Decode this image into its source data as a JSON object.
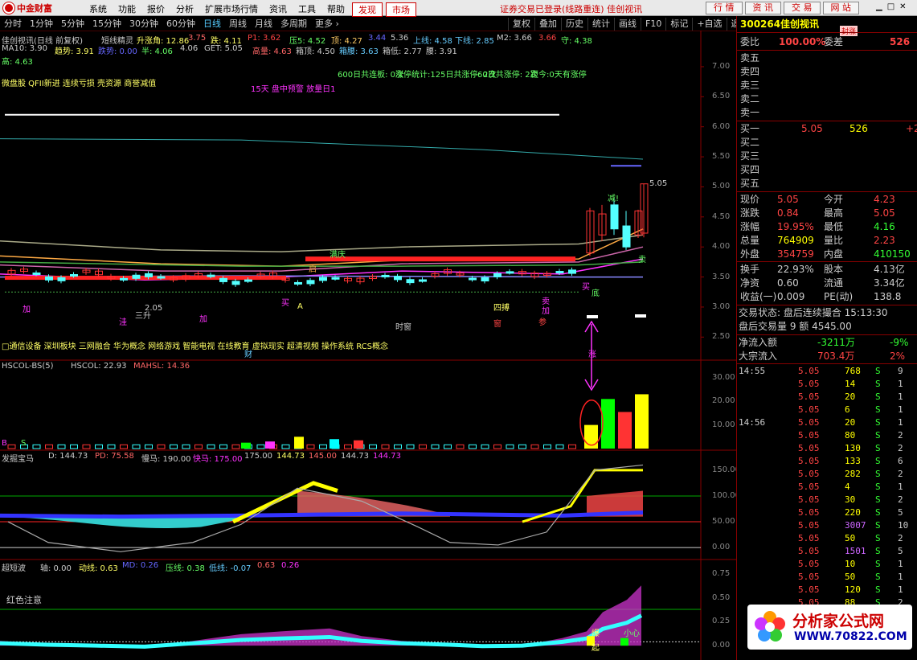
{
  "app": {
    "brand": "中金财富",
    "menu": [
      "系统",
      "功能",
      "报价",
      "分析",
      "扩展市场行情",
      "资讯",
      "工具",
      "帮助"
    ],
    "menu_red": [
      "发现",
      "市场"
    ],
    "notice": "证券交易已登录(线路重连) 佳创视讯",
    "top_buttons": [
      "行 情",
      "资 讯",
      "交 易",
      "网 站"
    ]
  },
  "periods": [
    "分时",
    "1分钟",
    "5分钟",
    "15分钟",
    "30分钟",
    "60分钟",
    "日线",
    "周线",
    "月线",
    "多周期",
    "更多 ›"
  ],
  "active_period": "日线",
  "tools": [
    "复权",
    "叠加",
    "历史",
    "统计",
    "画线",
    "F10",
    "标记",
    "+自选",
    "返回"
  ],
  "main": {
    "title": "佳创视讯(日线 前复权)",
    "indicator": "短线精灵",
    "l1": [
      [
        "升涨角: 12.86",
        "#ff6"
      ],
      [
        "3.75",
        "#f66"
      ],
      [
        "跌: 4.11",
        "#ff6"
      ],
      [
        "P1: 3.62",
        "#f44"
      ],
      [
        "压5: 4.52",
        "#6f6"
      ],
      [
        "顶: 4.27",
        "#fc6"
      ],
      [
        "3.44",
        "#66f"
      ],
      [
        "5.36",
        "#ccc"
      ],
      [
        "上线: 4.58",
        "#6cf"
      ],
      [
        "下线: 2.85",
        "#6cf"
      ],
      [
        "M2: 3.66",
        "#ccc"
      ],
      [
        "3.66",
        "#f44"
      ],
      [
        "守: 4.38",
        "#6f6"
      ]
    ],
    "l2": [
      [
        "MA10: 3.90",
        "#ccc"
      ],
      [
        "趋势: 3.91",
        "#ff6"
      ],
      [
        "跌势: 0.00",
        "#66f"
      ],
      [
        "半: 4.06",
        "#6f6"
      ],
      [
        "4.06",
        "#ccc"
      ],
      [
        "GET: 5.05",
        "#ccc"
      ],
      [
        "高量: 4.63",
        "#f66"
      ],
      [
        "箱顶: 4.50",
        "#ccc"
      ],
      [
        "箱腰: 3.63",
        "#6cf"
      ],
      [
        "箱低: 2.77",
        "#ccc"
      ],
      [
        "腰: 3.91",
        "#ccc"
      ]
    ],
    "l3": "高: 4.63",
    "stats": [
      "600日共连板: 0次",
      "涨停统计:125日共涨停: 2次",
      "60日共涨停: 2次",
      "距今:0天有涨停"
    ],
    "concept1": "微盘股 QFII新进 连续亏损 壳资源 商誉减值",
    "warn": "15天 盘中预警 放量日1",
    "concept2": "□通信设备 深圳板块 三网融合 华为概念 网络游戏 智能电视 在线教育 虚拟现实 超清视频 操作系统 RCS概念",
    "yticks": [
      "7.00",
      "6.50",
      "6.00",
      "5.50",
      "5.00",
      "4.50",
      "4.00",
      "3.50",
      "3.00",
      "2.50"
    ],
    "price_tag": "5.05",
    "marks": [
      "加",
      "洼",
      "三升",
      "加",
      "A",
      "买",
      "时窗",
      "四搏",
      "窗",
      "加",
      "卖",
      "参",
      "减!",
      "满庆",
      "启",
      "底",
      "卖",
      "涨",
      "买",
      "财",
      "2.05"
    ]
  },
  "sub1": {
    "title": "HSCOL-BS(5)",
    "vals": [
      [
        "HSCOL: 22.93",
        "#ccc"
      ],
      [
        "MAHSL: 14.36",
        "#f66"
      ]
    ],
    "yticks": [
      "30.00",
      "20.00",
      "10.00"
    ]
  },
  "sub2": {
    "title": "发掘宝马",
    "vals": [
      [
        "D: 144.73",
        "#ccc"
      ],
      [
        "PD: 75.58",
        "#f66"
      ],
      [
        "慢马: 190.00",
        "#ccc"
      ],
      [
        "快马: 175.00",
        "#f3f"
      ],
      [
        "175.00",
        "#ccc"
      ],
      [
        "144.73",
        "#ff6"
      ],
      [
        "145.00",
        "#f66"
      ],
      [
        "144.73",
        "#ccc"
      ],
      [
        "144.73",
        "#f3f"
      ]
    ],
    "yticks": [
      "150.00",
      "100.00",
      "50.00",
      "0.00"
    ]
  },
  "sub3": {
    "title": "超短波",
    "vals": [
      [
        "轴: 0.00",
        "#ccc"
      ],
      [
        "动线: 0.63",
        "#ff6"
      ],
      [
        "MD: 0.26",
        "#66f"
      ],
      [
        "压线: 0.38",
        "#6f6"
      ],
      [
        "低线: -0.07",
        "#6cf"
      ],
      [
        "0.63",
        "#f66"
      ],
      [
        "0.26",
        "#f3f"
      ]
    ],
    "label": "红色注意",
    "marks": [
      "爆",
      "起",
      "小心"
    ],
    "yticks": [
      "0.75",
      "0.50",
      "0.25",
      "0.00"
    ]
  },
  "quote": {
    "code": "300264",
    "name": "佳创视讯",
    "badge": "封涨",
    "webi_label": "委比",
    "webi_val": "100.00%",
    "weicha_label": "委差",
    "weicha_val": "526",
    "sells": [
      "卖五",
      "卖四",
      "卖三",
      "卖二",
      "卖一"
    ],
    "buys": [
      [
        "买一",
        "5.05",
        "526",
        "+2"
      ],
      [
        "买二",
        "",
        "",
        ""
      ],
      [
        "买三",
        "",
        "",
        ""
      ],
      [
        "买四",
        "",
        "",
        ""
      ],
      [
        "买五",
        "",
        "",
        ""
      ]
    ],
    "rows": [
      [
        "现价",
        "5.05",
        "今开",
        "4.23"
      ],
      [
        "涨跌",
        "0.84",
        "最高",
        "5.05"
      ],
      [
        "涨幅",
        "19.95%",
        "最低",
        "4.16"
      ],
      [
        "总量",
        "764909",
        "量比",
        "2.23"
      ],
      [
        "外盘",
        "354759",
        "内盘",
        "410150"
      ],
      [
        "换手",
        "22.93%",
        "股本",
        "4.13亿"
      ],
      [
        "净资",
        "0.60",
        "流通",
        "3.34亿"
      ],
      [
        "收益(一)",
        "0.009",
        "PE(动)",
        "138.8"
      ]
    ],
    "status": "交易状态: 盘后连续撮合 15:13:30",
    "after": "盘后交易量 9 额 4545.00",
    "flow": [
      [
        "净流入额",
        "-3211万",
        "-9%"
      ],
      [
        "大宗流入",
        "703.4万",
        "2%"
      ]
    ]
  },
  "ticks": [
    [
      "14:55",
      "5.05",
      "768",
      "S",
      "9"
    ],
    [
      "",
      "5.05",
      "14",
      "S",
      "1"
    ],
    [
      "",
      "5.05",
      "20",
      "S",
      "1"
    ],
    [
      "",
      "5.05",
      "6",
      "S",
      "1"
    ],
    [
      "14:56",
      "5.05",
      "20",
      "S",
      "1"
    ],
    [
      "",
      "5.05",
      "80",
      "S",
      "2"
    ],
    [
      "",
      "5.05",
      "130",
      "S",
      "2"
    ],
    [
      "",
      "5.05",
      "133",
      "S",
      "6"
    ],
    [
      "",
      "5.05",
      "282",
      "S",
      "2"
    ],
    [
      "",
      "5.05",
      "4",
      "S",
      "1"
    ],
    [
      "",
      "5.05",
      "30",
      "S",
      "2"
    ],
    [
      "",
      "5.05",
      "220",
      "S",
      "5"
    ],
    [
      "",
      "5.05",
      "3007",
      "S",
      "10"
    ],
    [
      "",
      "5.05",
      "50",
      "S",
      "2"
    ],
    [
      "",
      "5.05",
      "1501",
      "S",
      "5"
    ],
    [
      "",
      "5.05",
      "10",
      "S",
      "1"
    ],
    [
      "",
      "5.05",
      "50",
      "S",
      "1"
    ],
    [
      "",
      "5.05",
      "120",
      "S",
      "1"
    ],
    [
      "",
      "5.05",
      "88",
      "S",
      "2"
    ]
  ],
  "watermark": {
    "name": "分析家公式网",
    "url": "WWW.70822.COM"
  },
  "colors": {
    "up": "#ff3333",
    "down": "#54ffff",
    "yellow": "#ffff00",
    "magenta": "#ff33ff",
    "green": "#00ff00"
  }
}
